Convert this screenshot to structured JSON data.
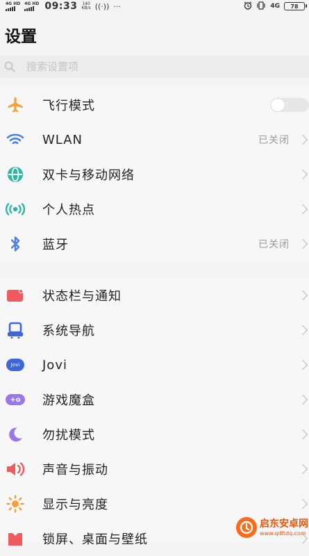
{
  "status_bar": {
    "sim1": "4G HD",
    "sim2": "4G HD",
    "time": "09:33",
    "speed_value": "140",
    "speed_unit": "KB/s",
    "nfc": "((·))",
    "more": "···",
    "network": "4G",
    "battery": "78"
  },
  "title": "设置",
  "search": {
    "placeholder": "搜索设置项"
  },
  "groups": [
    {
      "items": [
        {
          "label": "飞行模式",
          "icon": "airplane-icon",
          "toggle": false
        },
        {
          "label": "WLAN",
          "value": "已关闭",
          "icon": "wifi-icon"
        },
        {
          "label": "双卡与移动网络",
          "icon": "globe-icon"
        },
        {
          "label": "个人热点",
          "icon": "hotspot-icon"
        },
        {
          "label": "蓝牙",
          "value": "已关闭",
          "icon": "bluetooth-icon"
        }
      ]
    },
    {
      "items": [
        {
          "label": "状态栏与通知",
          "icon": "notification-icon"
        },
        {
          "label": "系统导航",
          "icon": "navigation-icon"
        },
        {
          "label": "Jovi",
          "icon": "jovi-icon",
          "icon_text": "Jovi"
        },
        {
          "label": "游戏魔盒",
          "icon": "gamepad-icon",
          "icon_text": "+o"
        },
        {
          "label": "勿扰模式",
          "icon": "moon-icon"
        },
        {
          "label": "声音与振动",
          "icon": "speaker-icon"
        },
        {
          "label": "显示与亮度",
          "icon": "sun-icon"
        },
        {
          "label": "锁屏、桌面与壁纸",
          "icon": "wallpaper-icon"
        }
      ]
    }
  ],
  "colors": {
    "orange": "#f2a03c",
    "blue": "#4a7ee8",
    "teal": "#2bb7a4",
    "red": "#f0595e",
    "purple": "#9a78e8",
    "indigo": "#3f66d9"
  },
  "watermark": {
    "name": "启东安卓网",
    "url": "www.qdltdq.com"
  }
}
